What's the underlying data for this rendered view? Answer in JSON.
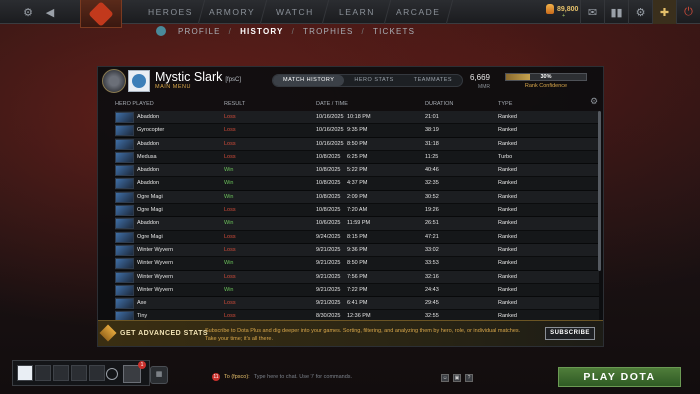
{
  "topnav": {
    "items": [
      "HEROES",
      "ARMORY",
      "WATCH",
      "LEARN",
      "ARCADE"
    ],
    "gold": "89,800",
    "gold_sub": "+"
  },
  "subnav": {
    "items": [
      "PROFILE",
      "HISTORY",
      "TROPHIES",
      "TICKETS"
    ],
    "active": "HISTORY",
    "sep": "/"
  },
  "profile": {
    "name": "Mystic Slark",
    "tag": "[fpsC]",
    "menu_label": "MAIN MENU",
    "mmr_value": "6,669",
    "mmr_label": "MMR",
    "rank_confidence_label": "Rank Confidence",
    "rank_confidence_pct": "30%",
    "rank_confidence_value": 0.3
  },
  "tabs": [
    "MATCH HISTORY",
    "HERO STATS",
    "TEAMMATES"
  ],
  "table": {
    "headers": [
      "HERO PLAYED",
      "RESULT",
      "DATE / TIME",
      "DURATION",
      "TYPE"
    ],
    "rows": [
      {
        "hero": "Abaddon",
        "result": "Loss",
        "date": "10/16/2025",
        "time": "10:18 PM",
        "duration": "21:01",
        "type": "Ranked"
      },
      {
        "hero": "Gyrocopter",
        "result": "Loss",
        "date": "10/16/2025",
        "time": "9:35 PM",
        "duration": "38:19",
        "type": "Ranked"
      },
      {
        "hero": "Abaddon",
        "result": "Loss",
        "date": "10/16/2025",
        "time": "8:50 PM",
        "duration": "31:18",
        "type": "Ranked"
      },
      {
        "hero": "Medusa",
        "result": "Loss",
        "date": "10/8/2025",
        "time": "6:25 PM",
        "duration": "11:25",
        "type": "Turbo"
      },
      {
        "hero": "Abaddon",
        "result": "Win",
        "date": "10/8/2025",
        "time": "5:22 PM",
        "duration": "40:46",
        "type": "Ranked"
      },
      {
        "hero": "Abaddon",
        "result": "Win",
        "date": "10/8/2025",
        "time": "4:37 PM",
        "duration": "32:35",
        "type": "Ranked"
      },
      {
        "hero": "Ogre Magi",
        "result": "Win",
        "date": "10/8/2025",
        "time": "2:09 PM",
        "duration": "30:52",
        "type": "Ranked"
      },
      {
        "hero": "Ogre Magi",
        "result": "Loss",
        "date": "10/8/2025",
        "time": "7:20 AM",
        "duration": "19:26",
        "type": "Ranked"
      },
      {
        "hero": "Abaddon",
        "result": "Win",
        "date": "10/6/2025",
        "time": "11:59 PM",
        "duration": "26:51",
        "type": "Ranked"
      },
      {
        "hero": "Ogre Magi",
        "result": "Loss",
        "date": "9/24/2025",
        "time": "8:15 PM",
        "duration": "47:21",
        "type": "Ranked"
      },
      {
        "hero": "Winter Wyvern",
        "result": "Loss",
        "date": "9/21/2025",
        "time": "9:36 PM",
        "duration": "33:02",
        "type": "Ranked"
      },
      {
        "hero": "Winter Wyvern",
        "result": "Win",
        "date": "9/21/2025",
        "time": "8:50 PM",
        "duration": "33:53",
        "type": "Ranked"
      },
      {
        "hero": "Winter Wyvern",
        "result": "Loss",
        "date": "9/21/2025",
        "time": "7:56 PM",
        "duration": "32:16",
        "type": "Ranked"
      },
      {
        "hero": "Winter Wyvern",
        "result": "Win",
        "date": "9/21/2025",
        "time": "7:22 PM",
        "duration": "24:43",
        "type": "Ranked"
      },
      {
        "hero": "Axe",
        "result": "Loss",
        "date": "9/21/2025",
        "time": "6:41 PM",
        "duration": "29:45",
        "type": "Ranked"
      },
      {
        "hero": "Tiny",
        "result": "Loss",
        "date": "8/30/2025",
        "time": "12:36 PM",
        "duration": "32:55",
        "type": "Ranked"
      }
    ]
  },
  "banner": {
    "title": "GET ADVANCED STATS",
    "text": "Subscribe to Dota Plus and dig deeper into your games. Sorting, filtering, and analyzing them by hero, role, or individual matches. Take your time; it's all there.",
    "button": "SUBSCRIBE"
  },
  "bottom": {
    "party_badge": "1",
    "chat_badge": "11",
    "chat_to": "To (fpsco):",
    "chat_placeholder": "Type here to chat. Use '/' for commands.",
    "chat_tool_help": "?",
    "play_label": "PLAY DOTA"
  },
  "colors": {
    "win": "#6bc25a",
    "loss": "#d24c3a",
    "accent_gold": "#d7a64a",
    "play_green": "#4f7d3a"
  }
}
